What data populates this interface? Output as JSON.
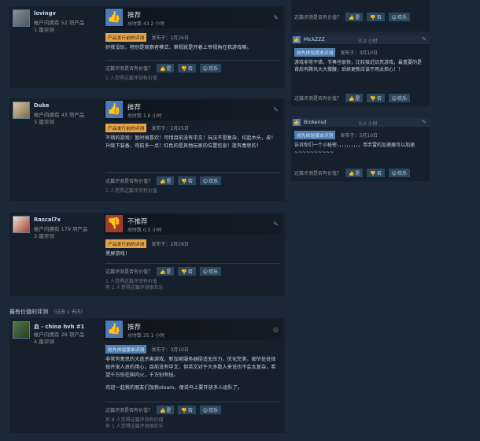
{
  "labels": {
    "recommended": "推荐",
    "not_recommended": "不推荐",
    "helpful_question": "这篇评测是否有价值？",
    "yes": "是",
    "no": "否",
    "funny": "欢乐",
    "tag_pre": "产品发行前的评测",
    "tag_ea": "抢先体验版本评测"
  },
  "reviews": [
    {
      "name": "lovingv",
      "owned": "帐户内拥有 52 项产品",
      "count": "1 篇评测",
      "vote": "推荐",
      "hours": "总时数 43.2 小时",
      "tag": "产品发行前的评测",
      "posted": "发布于：1月26日",
      "text": "好我没玩，特别是观察者模式，第视就是开着上帝视角在我游戏嘛。",
      "note": "1 人觉得这篇评测有价值"
    },
    {
      "name": "Duke",
      "owned": "帐户内拥有 43 项产品",
      "count": "5 篇评测",
      "vote": "推荐",
      "hours": "总时数 1.6 小时",
      "tag": "产品发行前的评测",
      "posted": "发布于：2月25日",
      "text": "不错的游戏！暂时很喜欢！可惜目前没有中文！玩法不是复杂，拉起木头，皮！升级下装备，鸡前多一点！红色的是其他玩家的位置信息！挺有意思的！",
      "note": "1 人觉得这篇评测有价值"
    },
    {
      "name": "Rascal7x",
      "owned": "帐户内拥有 179 项产品",
      "count": "3 篇评测",
      "vote": "不推荐",
      "hours": "总时数 0.5 小时",
      "tag": "产品发行前的评测",
      "posted": "发布于：2月28日",
      "text": "黑屏游戏！",
      "note1": "1 人觉得这篇评测有价值",
      "note2": "有 1 人觉得这篇评测很欢乐"
    },
    {
      "name": "血 - china hvh #1",
      "owned": "帐户内拥有 28 项产品",
      "count": "4 篇评测",
      "vote": "推荐",
      "hours": "总时数 25.1 小时",
      "tag": "抢先体验版本评测",
      "posted": "发布于：3月10日",
      "text1": "非常有意思的大逃杀类游戏，新加坡服务器挺适无压力，优化完美，细节处处体现开发人员的用心，目前没有中文，但英文对于大多数人来说也不会太复杂，希望千万别在国内火，千万别有挂。",
      "text2": "欢迎一起我的朋友们加我steam，便说马上要开放多人组队了。",
      "note1": "有 8 人觉得这篇评测有价值",
      "note2": "有 1 人觉得这篇评测很欢乐"
    }
  ],
  "section": {
    "title": "最有价值的评测",
    "range": "（过去 1 天内）"
  },
  "side": [
    {
      "name": "MickZZZ",
      "hours": "0.2 小时",
      "tag": "抢先体验版本评测",
      "posted": "发布于：3月10日",
      "text": "游戏非常不错，节奏也很快，比较接近饥荒游戏，最重要的是背后有腾讯大大撑腰，后续更新应该不用太担心！！"
    },
    {
      "name": "Brokensd",
      "hours": "0.2 小时",
      "tag": "抢先体验版本评测",
      "posted": "发布于：3月10日",
      "text": "告诉你们一个小秘密，，，，，，，，，，用手雷的加速器可以加速 ~~~~~~~~~~"
    }
  ]
}
